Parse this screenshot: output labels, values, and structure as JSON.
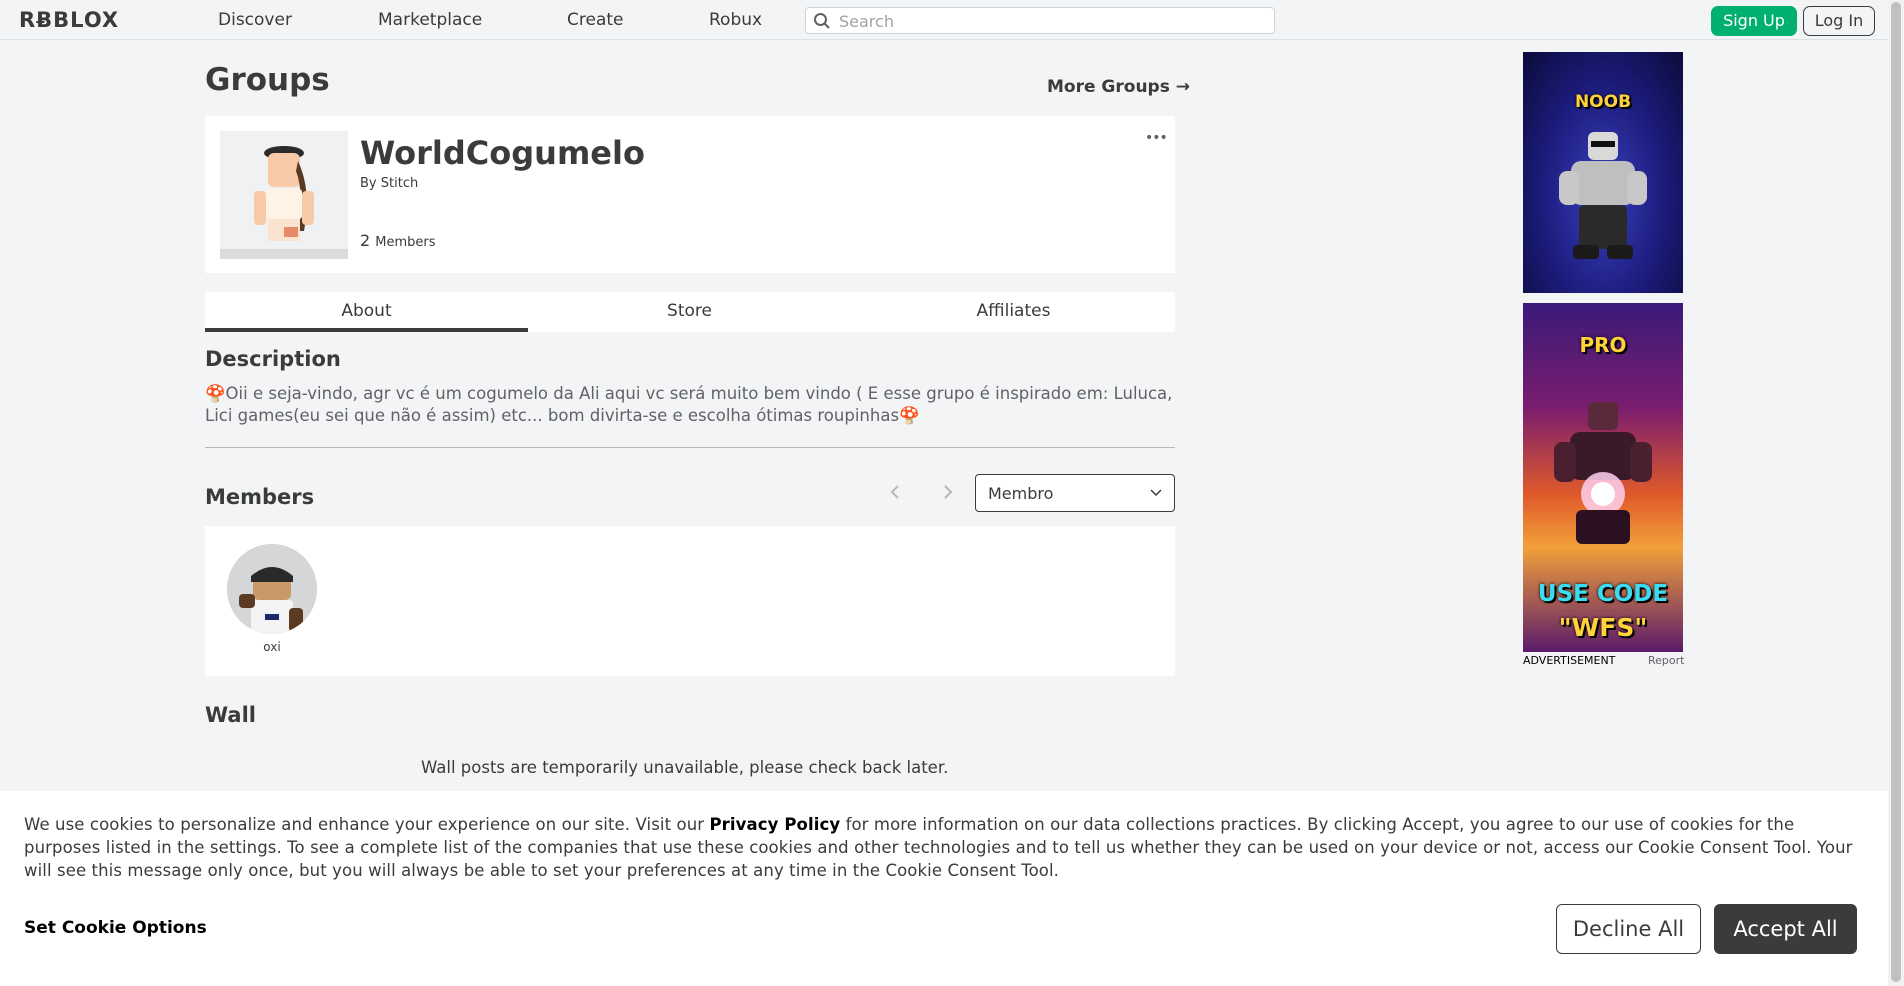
{
  "nav": {
    "logo": "RɃBLOX",
    "links": [
      "Discover",
      "Marketplace",
      "Create",
      "Robux"
    ],
    "search_placeholder": "Search",
    "signup": "Sign Up",
    "login": "Log In"
  },
  "page": {
    "heading": "Groups",
    "more_groups": "More Groups →"
  },
  "group": {
    "name": "WorldCogumelo",
    "by_prefix": "By",
    "owner": "Stitch",
    "member_count": "2",
    "member_label": "Members",
    "more_menu": "•••"
  },
  "tabs": [
    "About",
    "Store",
    "Affiliates"
  ],
  "active_tab": "About",
  "description": {
    "heading": "Description",
    "text": "🍄Oii e seja-vindo, agr vc é um cogumelo da Ali aqui vc será muito bem vindo ( E esse grupo é inspirado em: Luluca, Lici games(eu sei que não é assim) etc... bom divirta-se e escolha ótimas roupinhas🍄"
  },
  "members": {
    "heading": "Members",
    "role_selected": "Membro",
    "list": [
      {
        "name": "oxi"
      }
    ]
  },
  "wall": {
    "heading": "Wall",
    "message": "Wall posts are temporarily unavailable, please check back later."
  },
  "ads": {
    "ad1_text": "NOOB",
    "ad2_top": "PRO",
    "ad2_line1": "USE CODE",
    "ad2_line2": "\"WFS\"",
    "label": "ADVERTISEMENT",
    "report": "Report"
  },
  "cookie": {
    "text_before": "We use cookies to personalize and enhance your experience on our site. Visit our ",
    "link": "Privacy Policy",
    "text_after": " for more information on our data collections practices. By clicking Accept, you agree to our use of cookies for the purposes listed in the settings. To see a complete list of the companies that use these cookies and other technologies and to tell us whether they can be used on your device or not, access our Cookie Consent Tool. Your will see this message only once, but you will always be able to set your preferences at any time in the Cookie Consent Tool.",
    "options": "Set Cookie Options",
    "decline": "Decline All",
    "accept": "Accept All"
  }
}
